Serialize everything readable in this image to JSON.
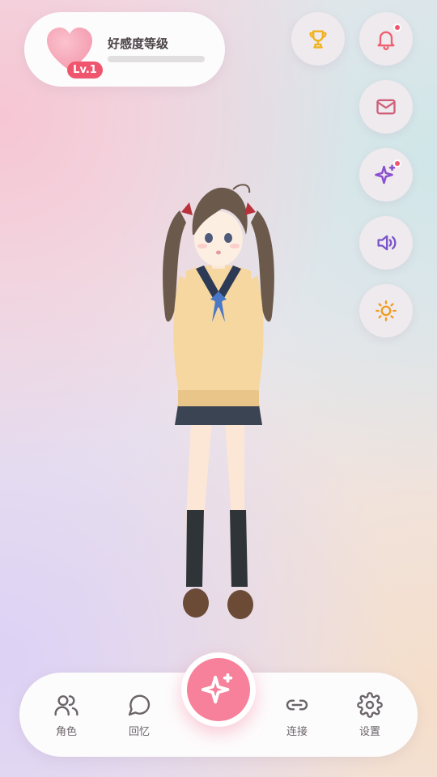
{
  "affinity": {
    "title": "好感度等级",
    "level_label": "Lv.1",
    "progress": 0,
    "icon": "heart-icon",
    "colors": {
      "heart": "#f7a6b6",
      "badge": "#f0556e",
      "track": "#e2dfe1"
    }
  },
  "side_actions": [
    {
      "id": "achievements",
      "icon": "trophy-icon",
      "color": "#f2b21c",
      "has_notification": false
    },
    {
      "id": "notifications",
      "icon": "bell-icon",
      "color": "#f06070",
      "has_notification": true
    },
    {
      "id": "messages",
      "icon": "mail-icon",
      "color": "#d0607a",
      "has_notification": false
    },
    {
      "id": "sparkle",
      "icon": "sparkle-icon",
      "color": "#8c4fcf",
      "has_notification": true
    },
    {
      "id": "sound",
      "icon": "speaker-icon",
      "color": "#7a55c8",
      "has_notification": false
    },
    {
      "id": "brightness",
      "icon": "sun-icon",
      "color": "#f29a1c",
      "has_notification": false
    }
  ],
  "character": {
    "icon": "anime-schoolgirl-illustration"
  },
  "bottom_nav": {
    "items": [
      {
        "label": "角色",
        "icon": "users-icon"
      },
      {
        "label": "回忆",
        "icon": "chat-bubble-icon"
      },
      {
        "label": "连接",
        "icon": "link-icon"
      },
      {
        "label": "设置",
        "icon": "gear-icon"
      }
    ],
    "center_action": {
      "icon": "sparkle-icon",
      "color": "#f7809a"
    }
  }
}
